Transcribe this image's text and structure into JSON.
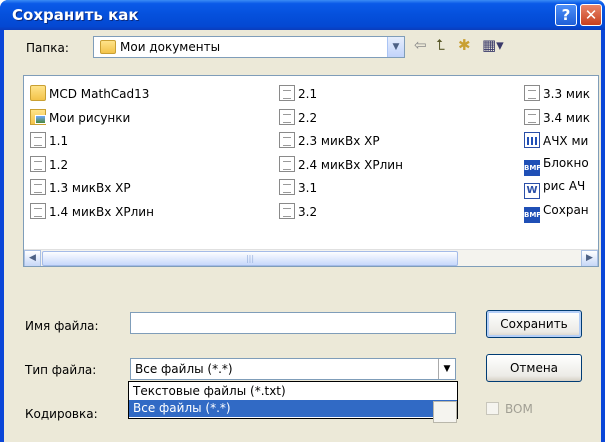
{
  "window": {
    "title": "Сохранить как",
    "help_glyph": "?",
    "close_glyph": "✕"
  },
  "toolbar": {
    "folder_label": "Папка:",
    "folder_value": "Мои документы",
    "back_glyph": "⇦",
    "up_glyph": "⮤",
    "new_folder_glyph": "✱",
    "view_glyph": "▦▾"
  },
  "files": [
    {
      "label": "MCD  MathCad13",
      "icon": "folder-icon"
    },
    {
      "label": "Мои рисунки",
      "icon": "pictures-folder-icon"
    },
    {
      "label": "1.1",
      "icon": "document-icon"
    },
    {
      "label": "1.2",
      "icon": "document-icon"
    },
    {
      "label": "1.3 микВх XP",
      "icon": "document-icon"
    },
    {
      "label": "1.4 микВх XPлин",
      "icon": "document-icon"
    },
    {
      "label": "2.1",
      "icon": "document-icon"
    },
    {
      "label": "2.2",
      "icon": "document-icon"
    },
    {
      "label": "2.3 микВх XP",
      "icon": "document-icon"
    },
    {
      "label": "2.4 микВх XPлин",
      "icon": "document-icon"
    },
    {
      "label": "3.1",
      "icon": "document-icon"
    },
    {
      "label": "3.2",
      "icon": "document-icon"
    },
    {
      "label": "3.3 мик",
      "icon": "document-icon"
    },
    {
      "label": "3.4 мик",
      "icon": "document-icon"
    },
    {
      "label": "АЧХ ми",
      "icon": "chart-icon"
    },
    {
      "label": "Блокно",
      "icon": "bmp-icon"
    },
    {
      "label": "рис АЧ",
      "icon": "word-icon"
    },
    {
      "label": "Сохран",
      "icon": "bmp-icon"
    }
  ],
  "scrollbar": {
    "left_glyph": "◀",
    "right_glyph": "▶",
    "thumb_grip": "|||"
  },
  "form": {
    "filename_label": "Имя файла:",
    "filename_value": "",
    "filetype_label": "Тип файла:",
    "filetype_value": "Все файлы (*.*)",
    "encoding_label": "Кодировка:",
    "filetype_options": [
      "Текстовые файлы (*.txt)",
      "Все файлы (*.*)"
    ],
    "bom_label": "BOM"
  },
  "buttons": {
    "save": "Сохранить",
    "cancel": "Отмена"
  }
}
